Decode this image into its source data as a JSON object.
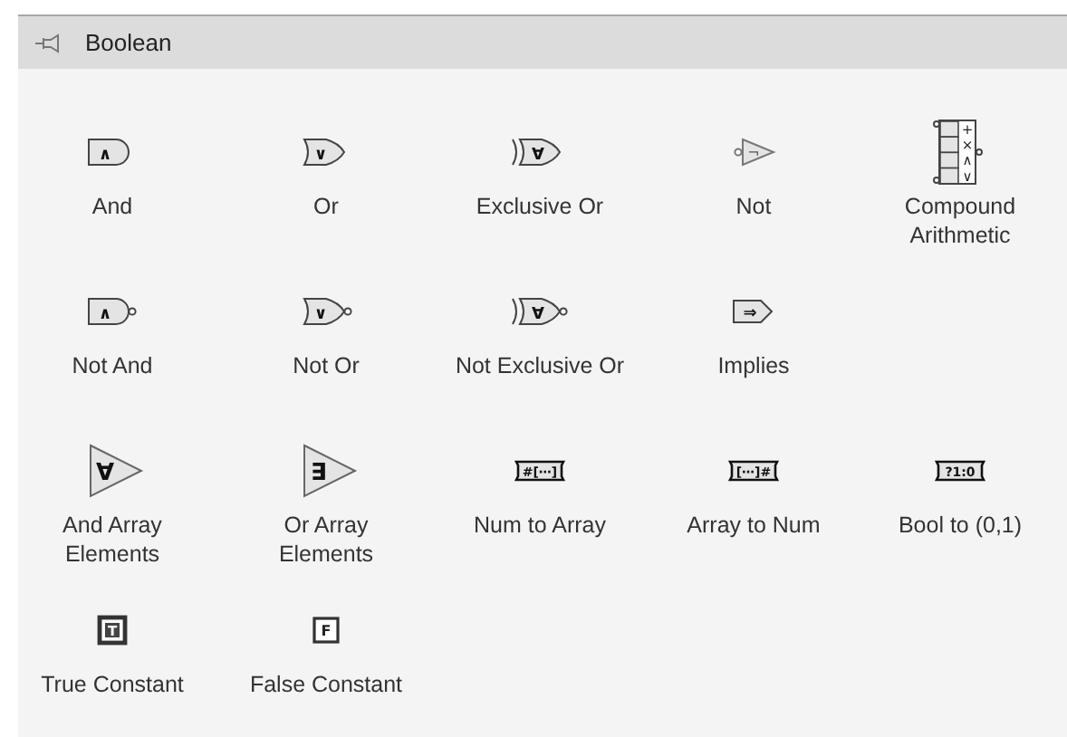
{
  "palette": {
    "title": "Boolean"
  },
  "rows": [
    [
      {
        "label": "And",
        "kind": "and",
        "symbol": "∧",
        "inverted": false
      },
      {
        "label": "Or",
        "kind": "or",
        "symbol": "∨",
        "inverted": false
      },
      {
        "label": "Exclusive Or",
        "kind": "xor",
        "symbol": "∀",
        "inverted": false
      },
      {
        "label": "Not",
        "kind": "not",
        "symbol": "¬",
        "inverted": false
      },
      {
        "label": "Compound Arithmetic",
        "kind": "compound",
        "symbols": [
          "+",
          "×",
          "∧",
          "∨"
        ]
      }
    ],
    [
      {
        "label": "Not And",
        "kind": "and",
        "symbol": "∧",
        "inverted": true
      },
      {
        "label": "Not Or",
        "kind": "or",
        "symbol": "∨",
        "inverted": true
      },
      {
        "label": "Not Exclusive Or",
        "kind": "xor",
        "symbol": "∀",
        "inverted": true
      },
      {
        "label": "Implies",
        "kind": "implies",
        "symbol": "⇒",
        "inverted": false
      }
    ],
    [
      {
        "label": "And Array Elements",
        "kind": "reduce",
        "symbol": "∀"
      },
      {
        "label": "Or Array Elements",
        "kind": "reduce",
        "symbol": "∃"
      },
      {
        "label": "Num to Array",
        "kind": "convert",
        "symbol": "#[⋯]"
      },
      {
        "label": "Array to Num",
        "kind": "convert",
        "symbol": "[⋯]#"
      },
      {
        "label": "Bool to (0,1)",
        "kind": "convert",
        "symbol": "?1:0"
      }
    ],
    [
      {
        "label": "True Constant",
        "kind": "true-constant",
        "symbol": "T"
      },
      {
        "label": "False Constant",
        "kind": "false-constant",
        "symbol": "F"
      }
    ]
  ]
}
